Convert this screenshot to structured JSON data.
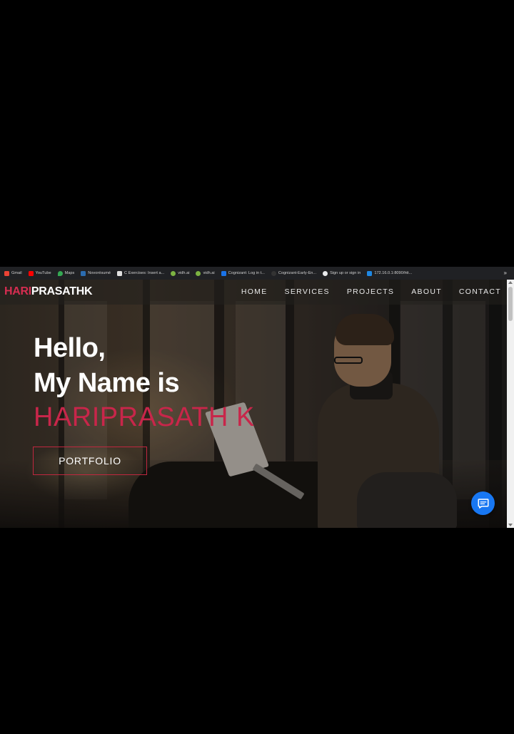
{
  "bookmarks": [
    {
      "label": "Gmail",
      "color": "#ea4335"
    },
    {
      "label": "YouTube",
      "color": "#ff0000"
    },
    {
      "label": "Maps",
      "color": "#34a853"
    },
    {
      "label": "Novorésumé",
      "color": "#2b6cb0"
    },
    {
      "label": "C Exercises: Insert a...",
      "color": "#e0e0e0"
    },
    {
      "label": "vidh.ai",
      "color": "#7cb342"
    },
    {
      "label": "vidh.ai",
      "color": "#7cb342"
    },
    {
      "label": "Cognizant: Log in t...",
      "color": "#1a73e8"
    },
    {
      "label": "Cognizant-Early-En...",
      "color": "#333333"
    },
    {
      "label": "Sign up or sign in",
      "color": "#e8eaed"
    },
    {
      "label": "172.16.0.1:8090/htt...",
      "color": "#1e88e5"
    }
  ],
  "bookmarks_more": "»",
  "logo": {
    "part1": "HARI",
    "part2": "PRASATHK"
  },
  "nav": [
    "HOME",
    "SERVICES",
    "PROJECTS",
    "ABOUT",
    "CONTACT"
  ],
  "hero": {
    "line1": "Hello,",
    "line2": "My Name is",
    "name": "HARIPRASATH K",
    "button": "PORTFOLIO"
  },
  "colors": {
    "accent": "#d62d51",
    "chat": "#1877f2"
  },
  "icons": {
    "chat": "chat-bubble-icon"
  }
}
